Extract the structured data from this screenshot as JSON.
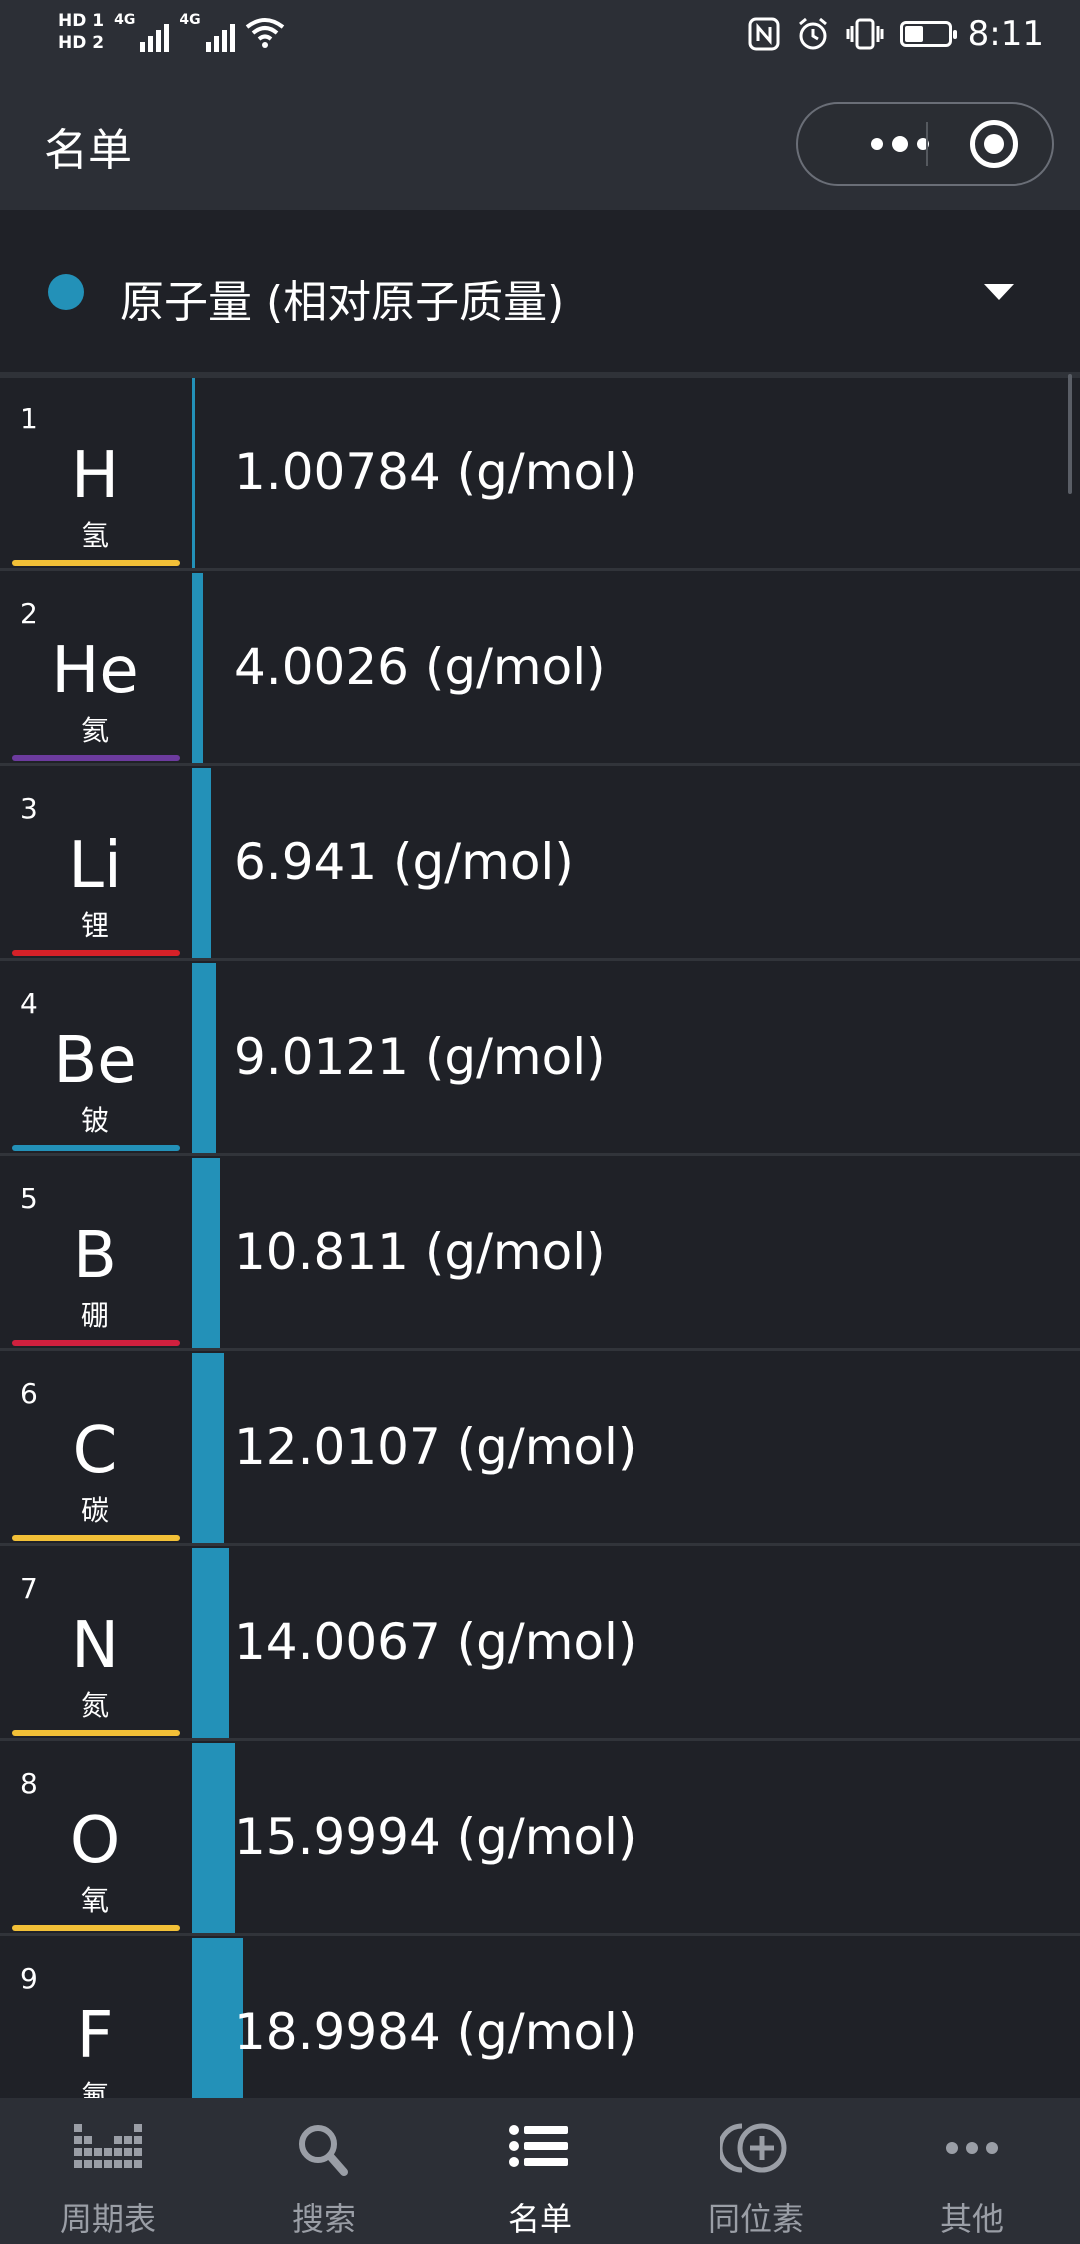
{
  "status_bar": {
    "sim1": "HD 1",
    "sim2": "HD 2",
    "network1": "4G",
    "network2": "4G",
    "time": "8:11"
  },
  "header": {
    "title": "名单"
  },
  "selector": {
    "label": "原子量 (相对原子质量)",
    "accent_color": "#2391b8"
  },
  "elements": [
    {
      "number": "1",
      "symbol": "H",
      "name": "氢",
      "value": "1.00784 (g/mol)",
      "bar_fraction": 0.003,
      "color": "#f2c037"
    },
    {
      "number": "2",
      "symbol": "He",
      "name": "氦",
      "value": "4.0026 (g/mol)",
      "bar_fraction": 0.012,
      "color": "#6c3b9e"
    },
    {
      "number": "3",
      "symbol": "Li",
      "name": "锂",
      "value": "6.941 (g/mol)",
      "bar_fraction": 0.021,
      "color": "#d62128"
    },
    {
      "number": "4",
      "symbol": "Be",
      "name": "铍",
      "value": "9.0121 (g/mol)",
      "bar_fraction": 0.027,
      "color": "#2391b8"
    },
    {
      "number": "5",
      "symbol": "B",
      "name": "硼",
      "value": "10.811 (g/mol)",
      "bar_fraction": 0.032,
      "color": "#d0203e"
    },
    {
      "number": "6",
      "symbol": "C",
      "name": "碳",
      "value": "12.0107 (g/mol)",
      "bar_fraction": 0.036,
      "color": "#f2c037"
    },
    {
      "number": "7",
      "symbol": "N",
      "name": "氮",
      "value": "14.0067 (g/mol)",
      "bar_fraction": 0.042,
      "color": "#f2c037"
    },
    {
      "number": "8",
      "symbol": "O",
      "name": "氧",
      "value": "15.9994 (g/mol)",
      "bar_fraction": 0.048,
      "color": "#f2c037"
    },
    {
      "number": "9",
      "symbol": "F",
      "name": "氟",
      "value": "18.9984 (g/mol)",
      "bar_fraction": 0.057,
      "color": "#f2c037"
    }
  ],
  "bottom_nav": [
    {
      "label": "周期表",
      "icon": "periodic-table-icon",
      "active": false
    },
    {
      "label": "搜索",
      "icon": "search-icon",
      "active": false
    },
    {
      "label": "名单",
      "icon": "list-icon",
      "active": true
    },
    {
      "label": "同位素",
      "icon": "isotope-icon",
      "active": false
    },
    {
      "label": "其他",
      "icon": "more-icon",
      "active": false
    }
  ]
}
